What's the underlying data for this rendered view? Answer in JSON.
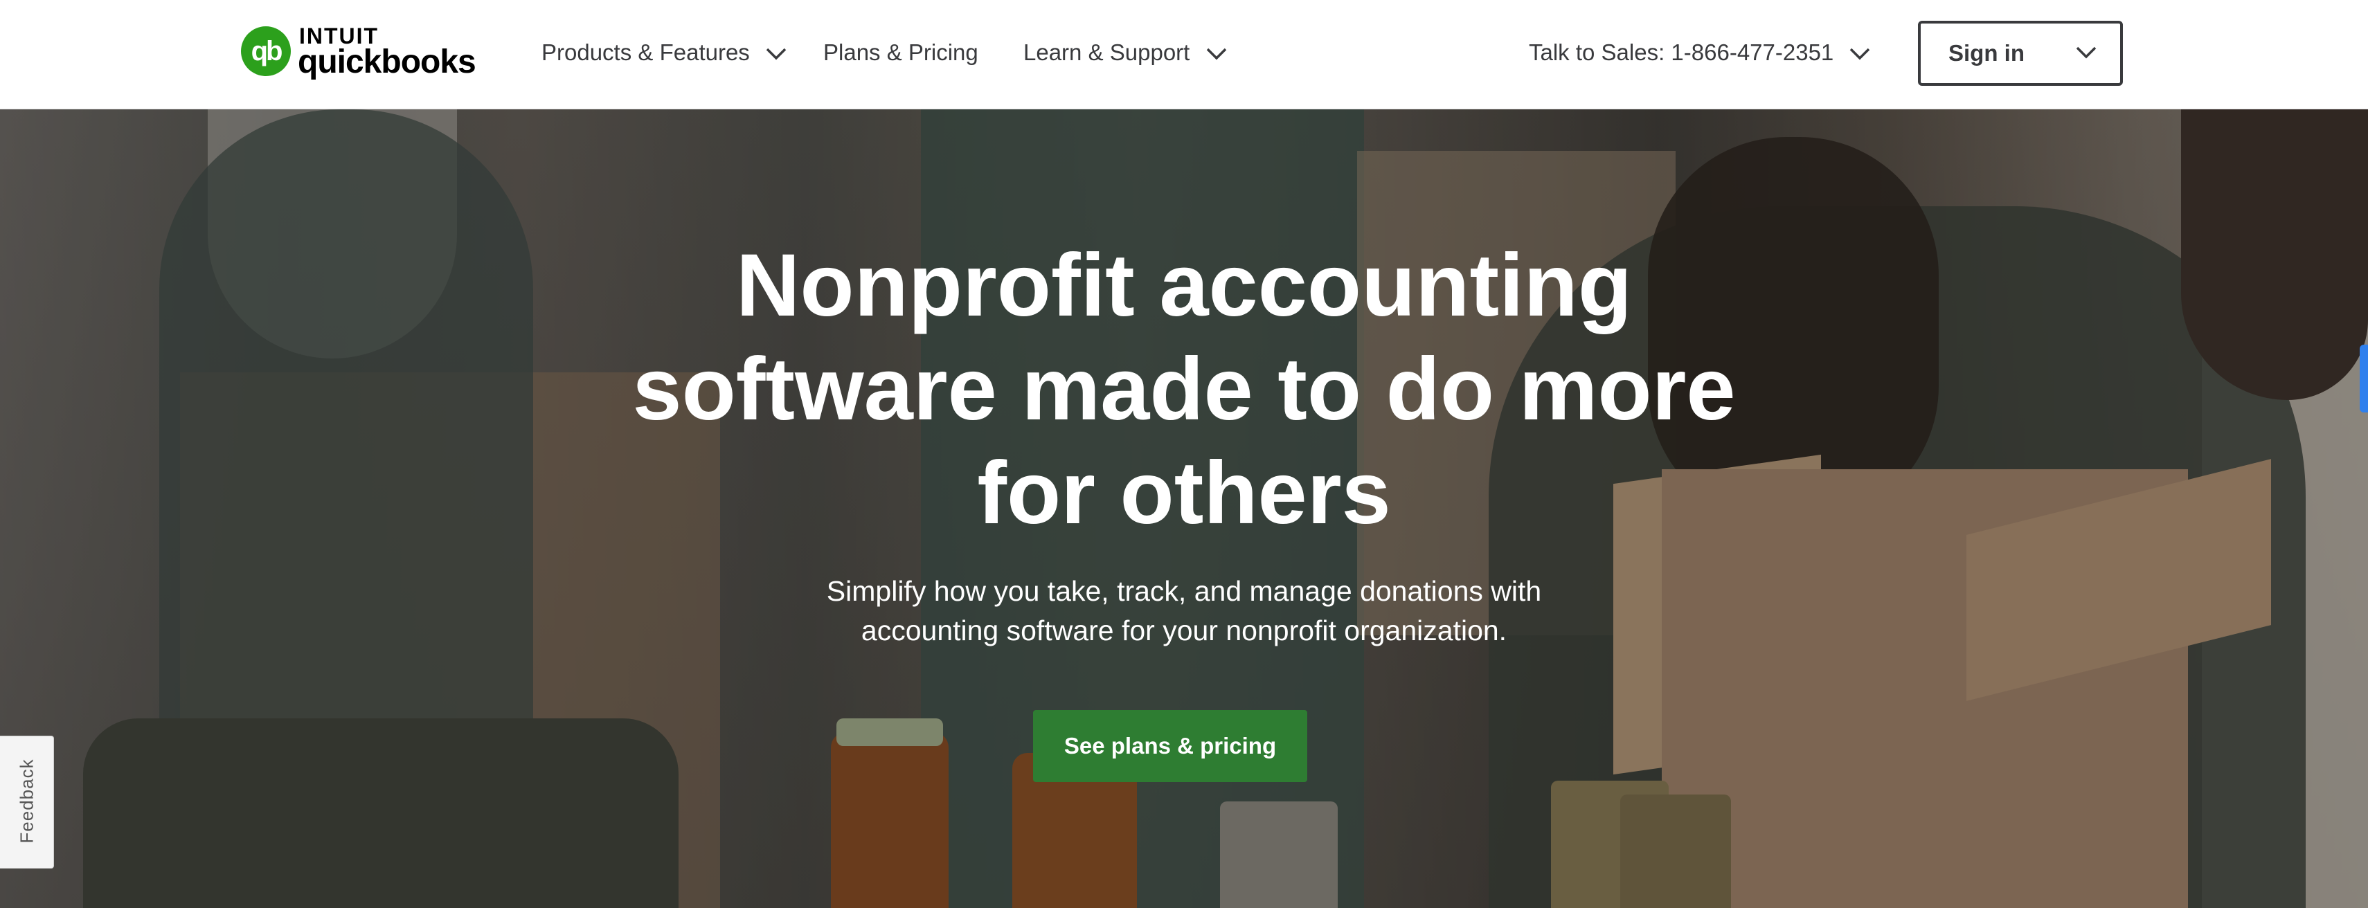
{
  "header": {
    "logo": {
      "brand_top": "INTUIT",
      "brand_main": "quickbooks",
      "mark": "qb"
    },
    "nav": [
      {
        "label": "Products & Features",
        "has_dropdown": true
      },
      {
        "label": "Plans & Pricing",
        "has_dropdown": false
      },
      {
        "label": "Learn & Support",
        "has_dropdown": true
      }
    ],
    "sales_phone": "Talk to Sales: 1-866-477-2351",
    "signin_label": "Sign in"
  },
  "hero": {
    "headline_lines": [
      "Nonprofit accounting",
      "software made to do more",
      "for others"
    ],
    "subtext_lines": [
      "Simplify how you take, track, and manage donations with",
      "accounting software for your nonprofit organization."
    ],
    "cta_label": "See plans & pricing"
  },
  "feedback_label": "Feedback",
  "colors": {
    "brand_green": "#2ca01c",
    "cta_green": "#2e7d32",
    "text_dark": "#393a3d",
    "scroll_accent": "#2f80ed"
  },
  "icons": {
    "dropdown": "chevron-down-icon",
    "logo": "quickbooks-logo-icon"
  }
}
